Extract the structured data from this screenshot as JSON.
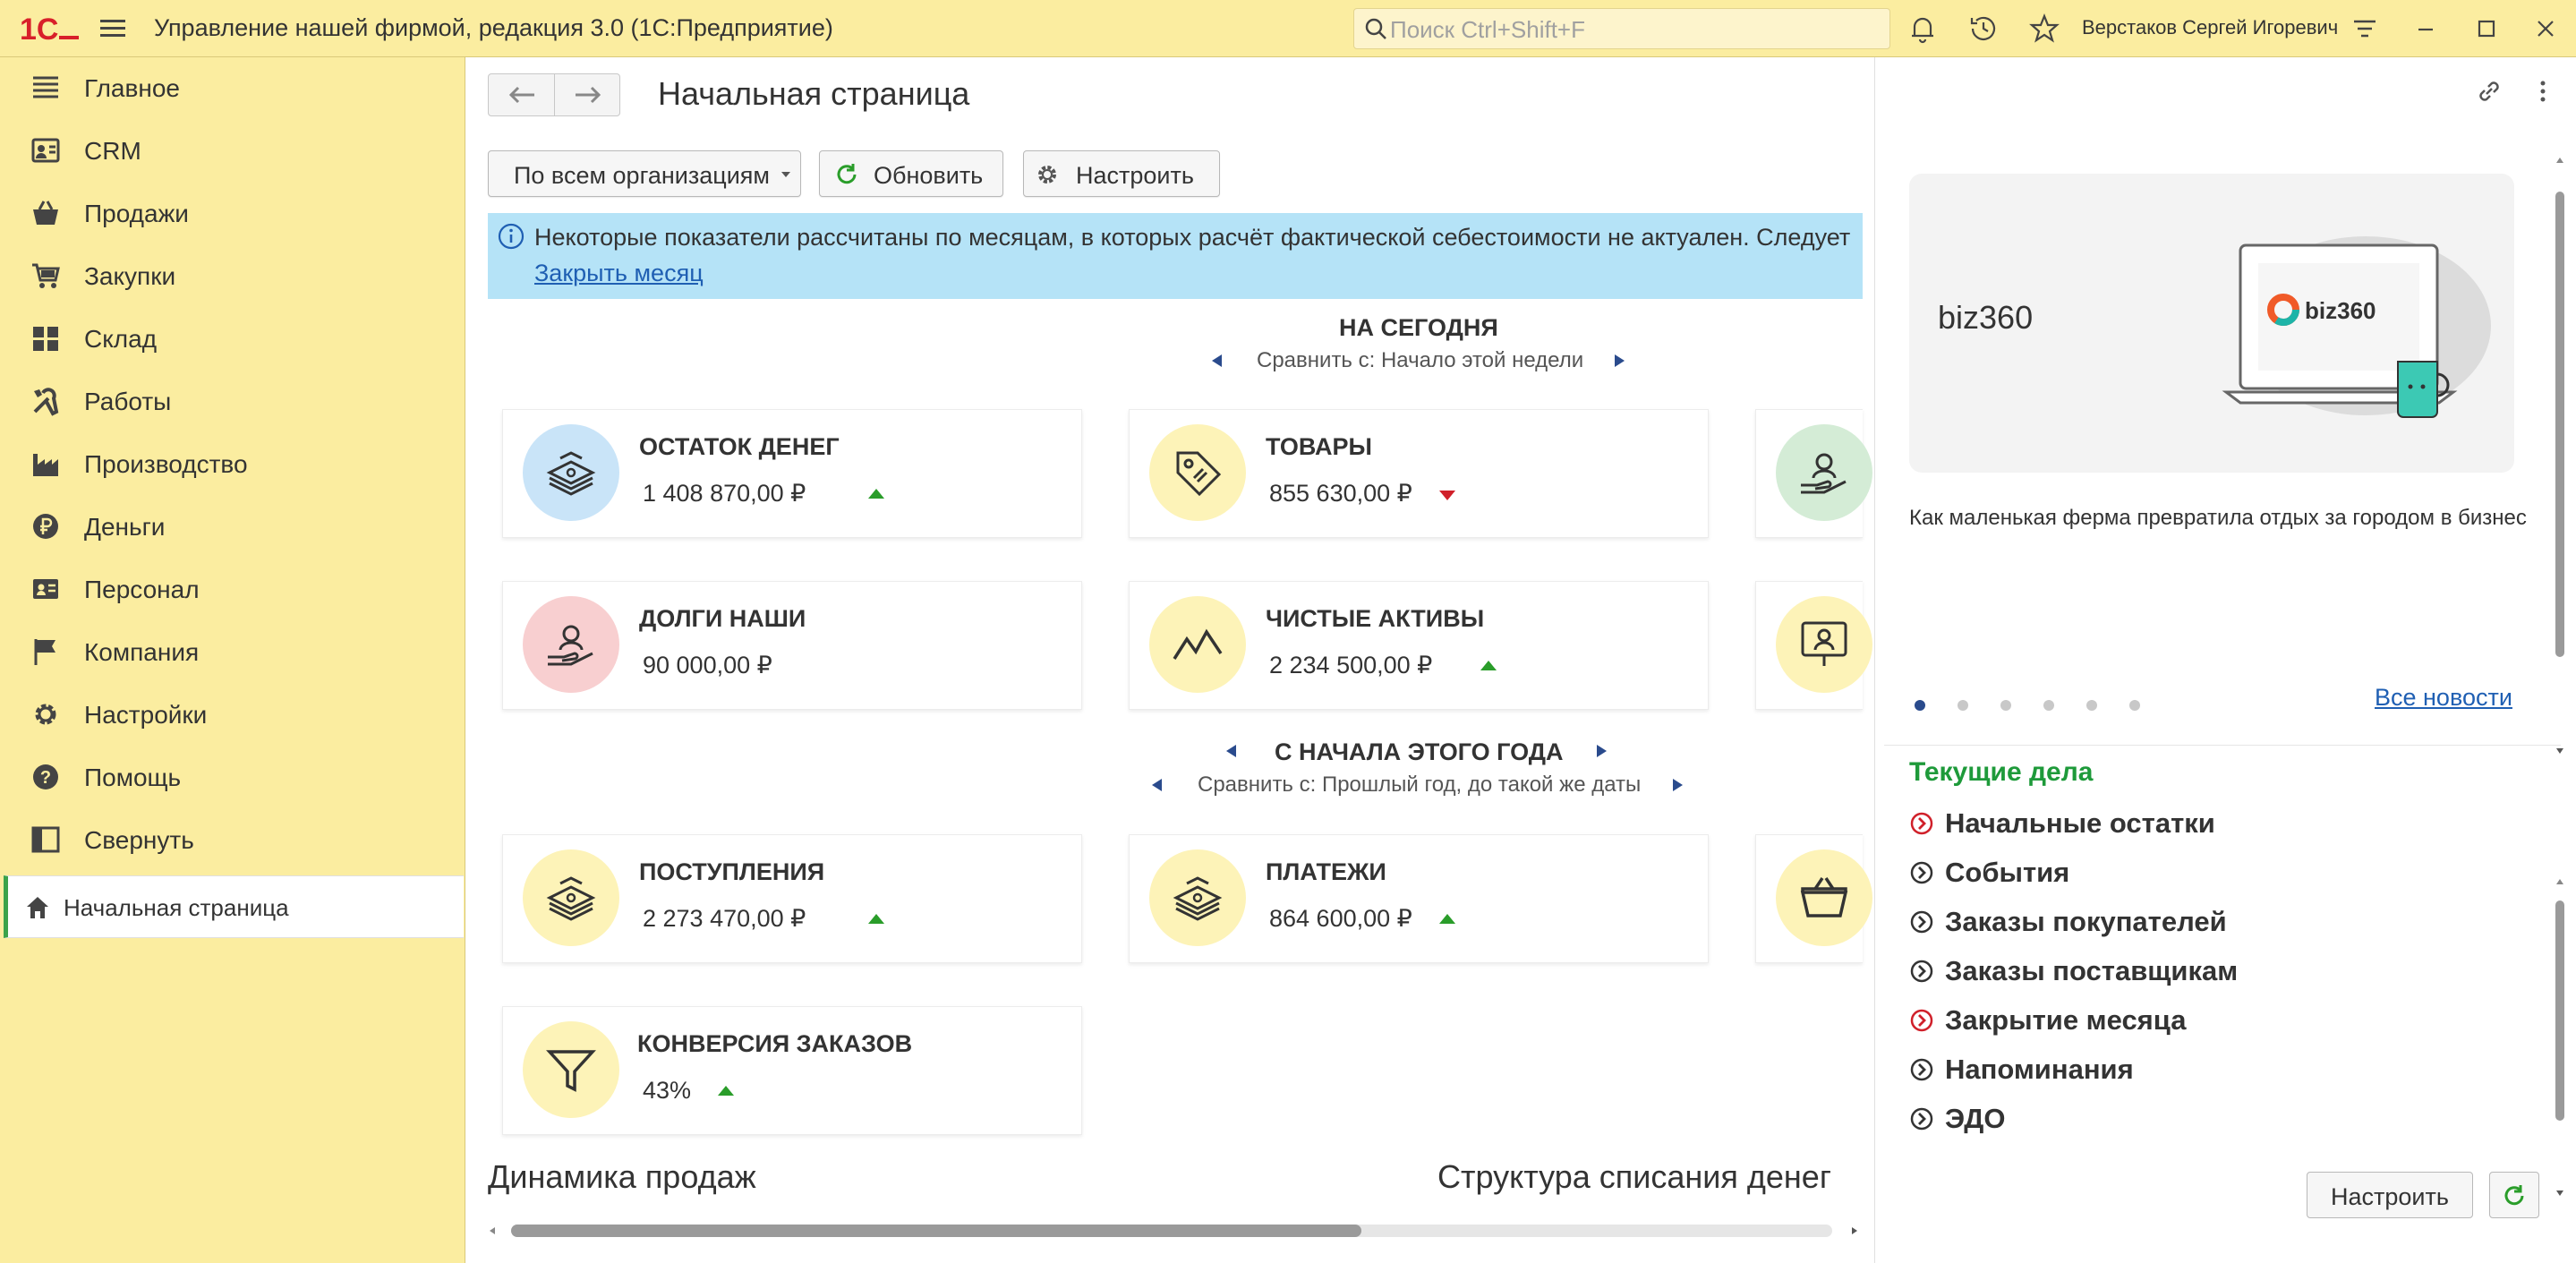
{
  "titlebar": {
    "app_title": "Управление нашей фирмой, редакция 3.0  (1С:Предприятие)",
    "search_placeholder": "Поиск Ctrl+Shift+F",
    "user_name": "Верстаков Сергей Игоревич"
  },
  "sidebar": {
    "items": [
      {
        "label": "Главное",
        "icon": "hamburger-list-icon"
      },
      {
        "label": "CRM",
        "icon": "contacts-icon"
      },
      {
        "label": "Продажи",
        "icon": "basket-icon"
      },
      {
        "label": "Закупки",
        "icon": "cart-icon"
      },
      {
        "label": "Склад",
        "icon": "grid-icon"
      },
      {
        "label": "Работы",
        "icon": "tools-icon"
      },
      {
        "label": "Производство",
        "icon": "factory-icon"
      },
      {
        "label": "Деньги",
        "icon": "ruble-icon"
      },
      {
        "label": "Персонал",
        "icon": "id-card-icon"
      },
      {
        "label": "Компания",
        "icon": "flag-icon"
      },
      {
        "label": "Настройки",
        "icon": "gear-icon"
      },
      {
        "label": "Помощь",
        "icon": "question-icon"
      },
      {
        "label": "Свернуть",
        "icon": "collapse-icon"
      }
    ],
    "home_label": "Начальная страница"
  },
  "main": {
    "page_title": "Начальная страница",
    "org_select": "По всем организациям",
    "refresh_label": "Обновить",
    "settings_label": "Настроить",
    "info_text": "Некоторые показатели рассчитаны по месяцам, в которых расчёт фактической себестоимости не актуален. Следует",
    "info_link": "Закрыть месяц",
    "today": {
      "title": "НА СЕГОДНЯ",
      "compare": "Сравнить с: Начало этой недели"
    },
    "year": {
      "title": "С НАЧАЛА ЭТОГО ГОДА",
      "compare": "Сравнить с: Прошлый год, до такой же даты"
    },
    "cards": [
      {
        "title": "ОСТАТОК ДЕНЕГ",
        "value": "1 408 870,00 ₽",
        "trend": "up",
        "icon": "money-stack-icon",
        "color": "#c9e4f8"
      },
      {
        "title": "ТОВАРЫ",
        "value": "855 630,00 ₽",
        "trend": "down",
        "icon": "price-tag-icon",
        "color": "#fdf3b8"
      },
      {
        "title": "ДОЛГИ НАШИ",
        "value": "90 000,00 ₽",
        "trend": "none",
        "icon": "hand-person-icon",
        "color": "#f8cfd0"
      },
      {
        "title": "ЧИСТЫЕ АКТИВЫ",
        "value": "2 234 500,00 ₽",
        "trend": "up",
        "icon": "zigzag-chart-icon",
        "color": "#fdf3b8"
      },
      {
        "title": "ПОСТУПЛЕНИЯ",
        "value": "2 273 470,00 ₽",
        "trend": "up",
        "icon": "money-stack-icon",
        "color": "#fdf3b8"
      },
      {
        "title": "ПЛАТЕЖИ",
        "value": "864 600,00 ₽",
        "trend": "up",
        "icon": "money-stack-icon",
        "color": "#fdf3b8"
      },
      {
        "title": "КОНВЕРСИЯ ЗАКАЗОВ",
        "value": "43%",
        "trend": "up",
        "icon": "funnel-icon",
        "color": "#fdf3b8"
      }
    ],
    "partial_cards": [
      {
        "icon": "hand-person-icon",
        "color": "#d4ecd6"
      },
      {
        "icon": "presentation-person-icon",
        "color": "#fdf3b8"
      },
      {
        "icon": "basket-icon",
        "color": "#fdf3b8"
      }
    ],
    "sales_dynamics": "Динамика продаж",
    "writeoff_structure": "Структура списания денег"
  },
  "right_panel": {
    "banner_name": "biz360",
    "banner_logo_text": "biz360",
    "news_text": "Как маленькая ферма превратила отдых за городом в бизнес",
    "all_news": "Все новости",
    "slide_count": 6,
    "active_slide": 1,
    "tasks_title": "Текущие дела",
    "tasks": [
      {
        "label": "Начальные остатки",
        "alert": true
      },
      {
        "label": "События",
        "alert": false
      },
      {
        "label": "Заказы покупателей",
        "alert": false
      },
      {
        "label": "Заказы поставщикам",
        "alert": false
      },
      {
        "label": "Закрытие месяца",
        "alert": true
      },
      {
        "label": "Напоминания",
        "alert": false
      },
      {
        "label": "ЭДО",
        "alert": false
      }
    ],
    "settings_label": "Настроить"
  },
  "colors": {
    "accent_yellow": "#fbeda0",
    "info_blue": "#b5e3f7",
    "trend_up": "#2a9d2a",
    "trend_down": "#d0202a",
    "tasks_green": "#1e9a3a",
    "alert_red": "#d0202a",
    "link_blue": "#1f5fb3"
  }
}
